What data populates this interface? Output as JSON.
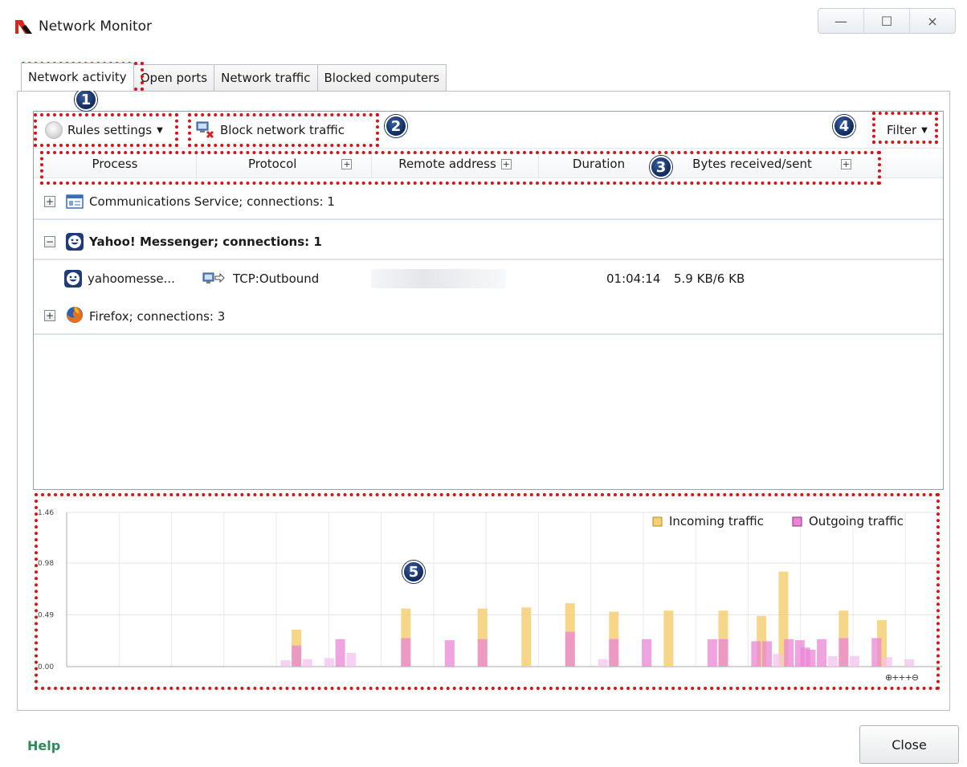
{
  "window": {
    "title": "Network Monitor",
    "controls": {
      "minimize": "—",
      "maximize": "☐",
      "close": "×"
    }
  },
  "tabs": [
    {
      "label": "Network activity",
      "active": true
    },
    {
      "label": "Open ports",
      "active": false
    },
    {
      "label": "Network traffic",
      "active": false
    },
    {
      "label": "Blocked computers",
      "active": false
    }
  ],
  "toolbar": {
    "rules_settings": "Rules settings",
    "block_traffic": "Block network traffic",
    "filter": "Filter"
  },
  "columns": {
    "process": "Process",
    "protocol": "Protocol",
    "remote_address": "Remote address",
    "duration": "Duration",
    "bytes": "Bytes received/sent"
  },
  "rows": [
    {
      "type": "group",
      "expanded": false,
      "label": "Communications Service; connections: 1",
      "icon": "window-app-icon"
    },
    {
      "type": "group",
      "expanded": true,
      "label": "Yahoo! Messenger; connections: 1",
      "icon": "yahoo-messenger-icon"
    },
    {
      "type": "connection",
      "process": "yahoomesse...",
      "protocol": "TCP:Outbound",
      "remote_address": "",
      "duration": "01:04:14",
      "bytes": "5.9 KB/6 KB"
    },
    {
      "type": "group",
      "expanded": false,
      "label": "Firefox; connections: 3",
      "icon": "firefox-icon"
    }
  ],
  "annotations": [
    "1",
    "2",
    "3",
    "4",
    "5"
  ],
  "colors": {
    "incoming": "#f4cf74",
    "outgoing": "#e985d6",
    "annotation": "#d01616",
    "help": "#2e8b57"
  },
  "chart_data": {
    "type": "bar",
    "y_ticks": [
      "1.46",
      "0.98",
      "0.49",
      "0.00"
    ],
    "ylim": [
      0,
      1.46
    ],
    "legend": [
      "Incoming traffic",
      "Outgoing traffic"
    ],
    "legend_position": "top-right",
    "grid": true,
    "zoom_controls": "⊕+++⊖",
    "series": [
      {
        "name": "Incoming traffic",
        "x": [
          21,
          31,
          38,
          42,
          46,
          50,
          55,
          60,
          63.5,
          65.5,
          71,
          74.5
        ],
        "values": [
          0.35,
          0.55,
          0.55,
          0.56,
          0.6,
          0.52,
          0.53,
          0.53,
          0.48,
          0.9,
          0.53,
          0.44
        ]
      },
      {
        "name": "Outgoing traffic",
        "x": [
          20,
          21,
          22,
          24,
          25,
          26,
          31,
          35,
          38,
          46,
          49,
          50,
          53,
          59,
          60,
          63,
          64,
          65,
          66,
          67,
          67.5,
          68,
          69,
          70,
          71,
          72,
          74,
          75,
          77
        ],
        "values": [
          0.06,
          0.2,
          0.07,
          0.08,
          0.26,
          0.13,
          0.27,
          0.25,
          0.26,
          0.33,
          0.07,
          0.26,
          0.26,
          0.26,
          0.26,
          0.24,
          0.24,
          0.12,
          0.26,
          0.25,
          0.18,
          0.16,
          0.26,
          0.1,
          0.27,
          0.1,
          0.27,
          0.09,
          0.07
        ]
      }
    ]
  },
  "footer": {
    "help": "Help",
    "close": "Close"
  }
}
